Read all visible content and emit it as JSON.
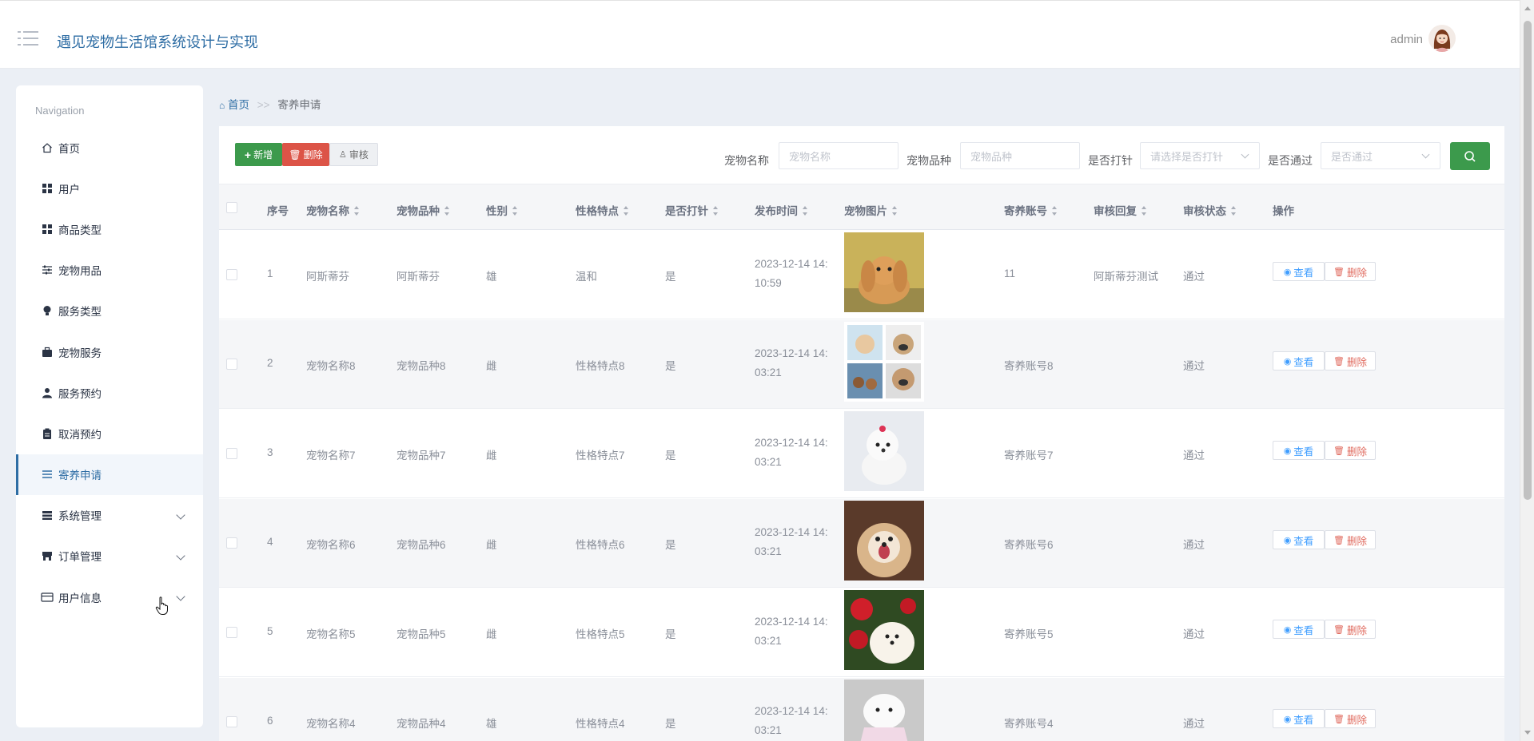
{
  "header": {
    "title": "遇见宠物生活馆系统设计与实现",
    "user": "admin"
  },
  "sidebar": {
    "heading": "Navigation",
    "items": [
      {
        "label": "首页",
        "icon": "home-icon"
      },
      {
        "label": "用户",
        "icon": "grid-icon"
      },
      {
        "label": "商品类型",
        "icon": "grid-icon"
      },
      {
        "label": "宠物用品",
        "icon": "sliders-icon"
      },
      {
        "label": "服务类型",
        "icon": "bulb-icon"
      },
      {
        "label": "宠物服务",
        "icon": "briefcase-icon"
      },
      {
        "label": "服务预约",
        "icon": "person-icon"
      },
      {
        "label": "取消预约",
        "icon": "clipboard-icon"
      },
      {
        "label": "寄养申请",
        "icon": "list-icon",
        "active": true
      },
      {
        "label": "系统管理",
        "icon": "table-icon",
        "expandable": true
      },
      {
        "label": "订单管理",
        "icon": "shop-icon",
        "expandable": true
      },
      {
        "label": "用户信息",
        "icon": "card-icon",
        "expandable": true
      }
    ]
  },
  "breadcrumb": {
    "home": "首页",
    "sep": ">>",
    "current": "寄养申请"
  },
  "toolbar": {
    "add": "新增",
    "delete": "删除",
    "audit": "审核"
  },
  "filters": {
    "name_label": "宠物名称",
    "name_placeholder": "宠物名称",
    "breed_label": "宠物品种",
    "breed_placeholder": "宠物品种",
    "vaccine_label": "是否打针",
    "vaccine_placeholder": "请选择是否打针",
    "pass_label": "是否通过",
    "pass_placeholder": "是否通过"
  },
  "table": {
    "columns": [
      "序号",
      "宠物名称",
      "宠物品种",
      "性别",
      "性格特点",
      "是否打针",
      "发布时间",
      "宠物图片",
      "寄养账号",
      "审核回复",
      "审核状态",
      "操作"
    ],
    "rows": [
      {
        "no": "1",
        "name": "阿斯蒂芬",
        "breed": "阿斯蒂芬",
        "sex": "雄",
        "trait": "温和",
        "vaccine": "是",
        "time": "2023-12-14 14:10:59",
        "account": "11",
        "reply": "阿斯蒂芬测试",
        "status": "通过",
        "img": "rabbit"
      },
      {
        "no": "2",
        "name": "宠物名称8",
        "breed": "宠物品种8",
        "sex": "雌",
        "trait": "性格特点8",
        "vaccine": "是",
        "time": "2023-12-14 14:03:21",
        "account": "寄养账号8",
        "reply": "",
        "status": "通过",
        "img": "collage"
      },
      {
        "no": "3",
        "name": "宠物名称7",
        "breed": "宠物品种7",
        "sex": "雌",
        "trait": "性格特点7",
        "vaccine": "是",
        "time": "2023-12-14 14:03:21",
        "account": "寄养账号7",
        "reply": "",
        "status": "通过",
        "img": "white-dog"
      },
      {
        "no": "4",
        "name": "宠物名称6",
        "breed": "宠物品种6",
        "sex": "雌",
        "trait": "性格特点6",
        "vaccine": "是",
        "time": "2023-12-14 14:03:21",
        "account": "寄养账号6",
        "reply": "",
        "status": "通过",
        "img": "shihtzu"
      },
      {
        "no": "5",
        "name": "宠物名称5",
        "breed": "宠物品种5",
        "sex": "雌",
        "trait": "性格特点5",
        "vaccine": "是",
        "time": "2023-12-14 14:03:21",
        "account": "寄养账号5",
        "reply": "",
        "status": "通过",
        "img": "roses-dog"
      },
      {
        "no": "6",
        "name": "宠物名称4",
        "breed": "宠物品种4",
        "sex": "雄",
        "trait": "性格特点4",
        "vaccine": "是",
        "time": "2023-12-14 14:03:21",
        "account": "寄养账号4",
        "reply": "",
        "status": "通过",
        "img": "dress-dog"
      }
    ],
    "actions": {
      "view": "查看",
      "delete": "删除"
    }
  },
  "colors": {
    "primary": "#2e6da4",
    "success": "#3c9a4c",
    "danger": "#dc5447",
    "link": "#409eff"
  }
}
